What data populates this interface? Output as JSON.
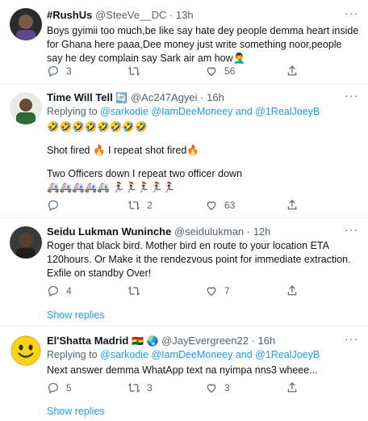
{
  "tweets": [
    {
      "name": "#RushUs",
      "handle": "@SteeVe__DC",
      "time": "· 13h",
      "text": "Boys gyimii too much,be like say hate dey people demma heart inside for Ghana here paaa,Dee money just write something noor,people say he dey complain say Sark air am how🤦‍♂️",
      "replies": "3",
      "retweets": "",
      "likes": "56"
    },
    {
      "name": "Time Will Tell",
      "handle": "@Ac247Agyei",
      "time": "· 16h",
      "reply_prefix": "Replying to",
      "reply_mentions": "@sarkodie @IamDeeMoneey and @1RealJoeyB",
      "line1": "🤣🤣🤣🤣🤣🤣🤣🤣",
      "line2": "Shot fired 🔥 I repeat shot fired🔥",
      "line3": "Two Officers down I repeat two officer down",
      "line4": "🚑🚑🚑🚑🚑 🏃‍♀️🏃‍♀️🏃‍♀️🏃‍♀️🏃‍♀️",
      "replies": "",
      "retweets": "2",
      "likes": "63"
    },
    {
      "name": "Seidu Lukman Wuninche",
      "handle": "@seidulukman",
      "time": "· 12h",
      "text": "Roger that black bird. Mother bird en route to your location ETA 120hours. Or Make it the rendezvous point for immediate extraction. Exfile on standby Over!",
      "replies": "4",
      "retweets": "",
      "likes": "7",
      "show_replies": "Show replies"
    },
    {
      "name": "El'Shatta Madrid",
      "handle": "@JayEvergreen22",
      "time": "· 16h",
      "reply_prefix": "Replying to",
      "reply_mentions": "@sarkodie @IamDeeMoneey and @1RealJoeyB",
      "text": "Next answer demma WhatApp text na nyimpa nns3 wheee...",
      "replies": "5",
      "retweets": "3",
      "likes": "3",
      "show_replies": "Show replies"
    }
  ],
  "colors": {
    "accent": "#1d9bf0",
    "muted": "#536471",
    "divider": "#eff3f4"
  }
}
